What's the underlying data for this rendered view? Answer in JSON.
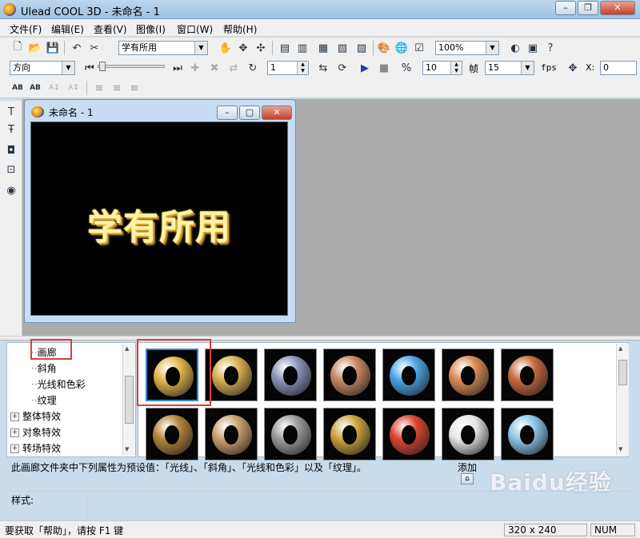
{
  "window": {
    "title": "Ulead COOL 3D - 未命名 - 1",
    "minimize": "–",
    "restore": "❐",
    "close": "✕"
  },
  "menubar": [
    "文件(F)",
    "编辑(E)",
    "查看(V)",
    "图像(I)",
    "窗口(W)",
    "帮助(H)"
  ],
  "toolbar1": {
    "text_combo": "学有所用",
    "zoom": "100%"
  },
  "toolbar2": {
    "direction": "方向",
    "frame_value": "1",
    "frame_count": "10",
    "frame_label": "帧",
    "fps_value": "15",
    "fps_label": "fps",
    "x_label": "X:",
    "x_value": "0"
  },
  "document": {
    "title": "未命名 - 1",
    "canvas_text": "学有所用",
    "btn_min": "–",
    "btn_max": "▢",
    "btn_close": "✕"
  },
  "tree": {
    "items": [
      "画廊",
      "斜角",
      "光线和色彩",
      "纹理"
    ],
    "groups": [
      "整体特效",
      "对象特效",
      "转场特效"
    ],
    "expander": "+"
  },
  "gallery": {
    "thumbnails": [
      {
        "name": "gold-ring",
        "color": "#e0b44a"
      },
      {
        "name": "gold-metal-ring",
        "color": "#d7b050"
      },
      {
        "name": "silver-chrome-ring",
        "color": "#8b93b8"
      },
      {
        "name": "copper-ring",
        "color": "#c98662"
      },
      {
        "name": "blue-crystal-ring",
        "color": "#4aa6e8"
      },
      {
        "name": "orange-tile-ring",
        "color": "#d98a55"
      },
      {
        "name": "terracotta-ring",
        "color": "#c6683c"
      },
      {
        "name": "bronze-texture-ring",
        "color": "#b48338"
      },
      {
        "name": "leopard-ring",
        "color": "#c9a070"
      },
      {
        "name": "grey-stone-ring",
        "color": "#9b9b9b"
      },
      {
        "name": "gold-speckle-ring",
        "color": "#caa23a"
      },
      {
        "name": "multicolor-ring",
        "color": "#d9442e"
      },
      {
        "name": "white-marble-ring",
        "color": "#e6e6e6"
      },
      {
        "name": "sky-ring",
        "color": "#8ec4e8"
      }
    ]
  },
  "description": "此画廊文件夹中下列属性为预设值：「光线」、「斜角」、「光线和色彩」以及「纹理」。",
  "add_button": "添加",
  "style_label": "样式:",
  "status": {
    "help": "要获取「帮助」，请按 F1 键",
    "size": "320 x 240",
    "num": "NUM"
  },
  "watermark": "Baidu经验"
}
